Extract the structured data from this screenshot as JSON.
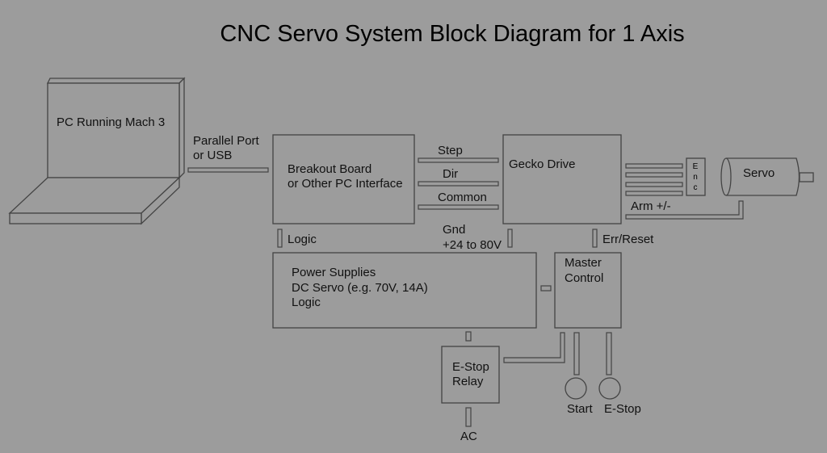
{
  "title": "CNC Servo System Block Diagram for 1 Axis",
  "colors": {
    "background": "#9c9c9c",
    "stroke": "#444444",
    "text": "#111111"
  },
  "blocks": {
    "pc": "PC Running Mach 3",
    "breakout": [
      "Breakout Board",
      "or Other PC Interface"
    ],
    "gecko": "Gecko Drive",
    "encoder": [
      "E",
      "n",
      "c"
    ],
    "servo": "Servo",
    "power": [
      "Power Supplies",
      "DC Servo (e.g. 70V, 14A)",
      "Logic"
    ],
    "master": [
      "Master",
      "Control"
    ],
    "estop_relay": [
      "E-Stop",
      "Relay"
    ]
  },
  "connections": {
    "pc_link": [
      "Parallel Port",
      "or USB"
    ],
    "step": "Step",
    "dir": "Dir",
    "common": "Common",
    "arm": "Arm +/-",
    "logic": "Logic",
    "power_out": [
      "Gnd",
      "+24 to 80V"
    ],
    "err_reset": "Err/Reset",
    "ac": "AC"
  },
  "buttons": {
    "start": "Start",
    "estop": "E-Stop"
  }
}
